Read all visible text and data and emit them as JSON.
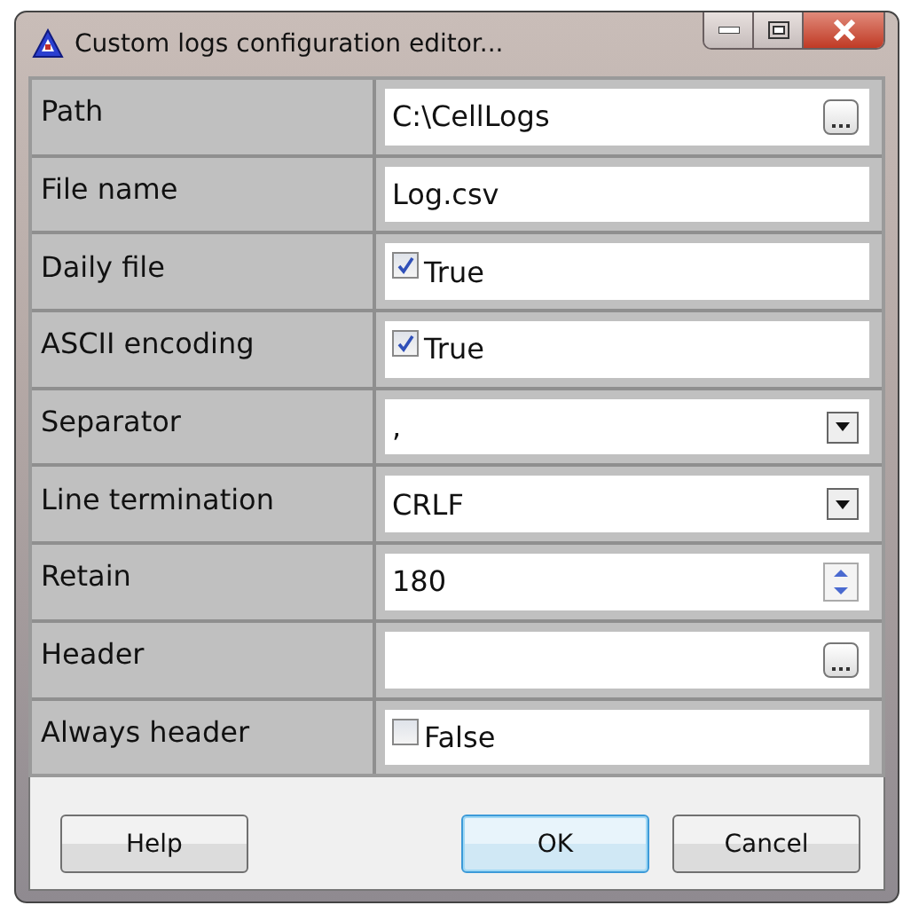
{
  "window": {
    "title": "Custom logs configuration editor..."
  },
  "properties": [
    {
      "label": "Path",
      "kind": "browse",
      "value": "C:\\CellLogs"
    },
    {
      "label": "File name",
      "kind": "text",
      "value": "Log.csv"
    },
    {
      "label": "Daily file",
      "kind": "check",
      "checked": true,
      "value": "True"
    },
    {
      "label": "ASCII encoding",
      "kind": "check",
      "checked": true,
      "value": "True"
    },
    {
      "label": "Separator",
      "kind": "dropdown",
      "value": ","
    },
    {
      "label": "Line termination",
      "kind": "dropdown",
      "value": "CRLF"
    },
    {
      "label": "Retain",
      "kind": "spin",
      "value": "180"
    },
    {
      "label": "Header",
      "kind": "browse"
    },
    {
      "label": "Always header",
      "kind": "check",
      "checked": false,
      "value": "False"
    }
  ],
  "buttons": [
    {
      "label": "Help",
      "default": false
    },
    {
      "label": "OK",
      "default": true
    },
    {
      "label": "Cancel",
      "default": false
    }
  ]
}
